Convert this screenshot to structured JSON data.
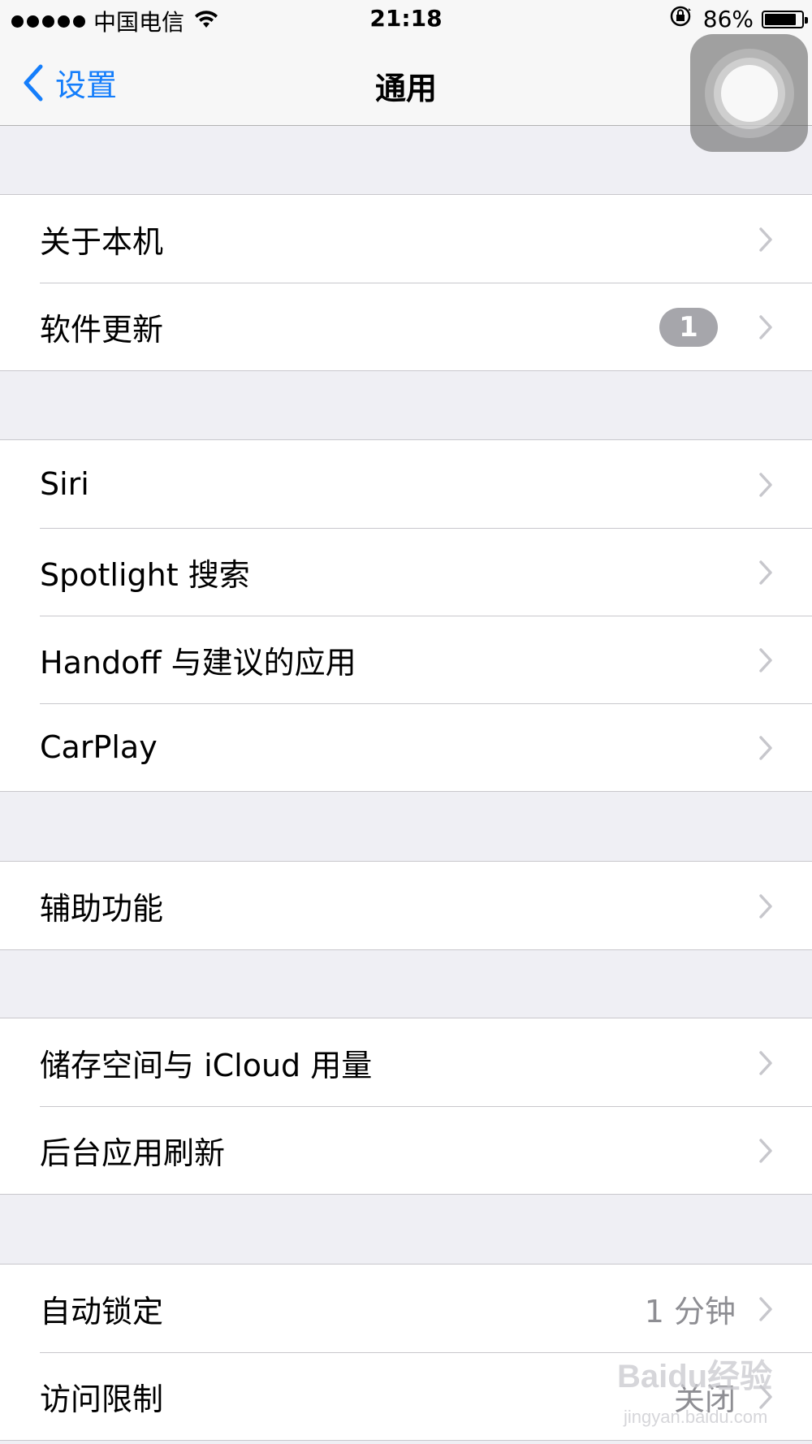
{
  "status_bar": {
    "carrier": "中国电信",
    "time": "21:18",
    "battery_percent": "86%",
    "battery_level": 0.86,
    "signal_bars": 5,
    "icons": [
      "signal-dots-icon",
      "wifi-icon",
      "orientation-lock-icon",
      "battery-icon"
    ]
  },
  "nav": {
    "back_label": "设置",
    "title": "通用"
  },
  "colors": {
    "accent": "#157efb",
    "background": "#efeff4",
    "separator": "#c8c7cc",
    "secondary_text": "#8e8e93",
    "badge": "#a6a6ab"
  },
  "groups": [
    {
      "rows": [
        {
          "label": "关于本机"
        },
        {
          "label": "软件更新",
          "badge": "1"
        }
      ]
    },
    {
      "rows": [
        {
          "label": "Siri"
        },
        {
          "label": "Spotlight 搜索"
        },
        {
          "label": "Handoff 与建议的应用"
        },
        {
          "label": "CarPlay"
        }
      ]
    },
    {
      "rows": [
        {
          "label": "辅助功能"
        }
      ]
    },
    {
      "rows": [
        {
          "label": "储存空间与 iCloud 用量"
        },
        {
          "label": "后台应用刷新"
        }
      ]
    },
    {
      "rows": [
        {
          "label": "自动锁定",
          "value": "1 分钟"
        },
        {
          "label": "访问限制",
          "value": "关闭"
        }
      ]
    }
  ],
  "watermark": {
    "text": "Baidu经验",
    "sub": "jingyan.baidu.com"
  }
}
